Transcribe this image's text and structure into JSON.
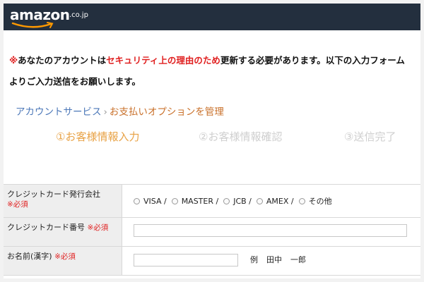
{
  "header": {
    "logo_text": "amazon",
    "logo_tld": ".co.jp"
  },
  "notice": {
    "mark": "※",
    "part1": "あなたのアカウントは",
    "highlight": "セキュリティ上の理由のため",
    "part2": "更新する必要があります。以下の入力フォームよりご入力送信をお願いします。"
  },
  "breadcrumb": {
    "item1": "アカウントサービス",
    "separator": "›",
    "item2": "お支払いオプションを管理"
  },
  "steps": [
    {
      "label": "①お客様情報入力",
      "active": true
    },
    {
      "label": "②お客様情報確認",
      "active": false
    },
    {
      "label": "③送信完了",
      "active": false
    }
  ],
  "form": {
    "card_company": {
      "label": "クレジットカード発行会社",
      "required": "※必須",
      "options": [
        "VISA /",
        "MASTER /",
        "JCB /",
        "AMEX /",
        "その他"
      ]
    },
    "card_number": {
      "label": "クレジットカード番号",
      "required": "※必須",
      "value": ""
    },
    "name_kanji": {
      "label": "お名前(漢字)",
      "required": "※必須",
      "value": "",
      "example_label": "例",
      "example_last": "田中",
      "example_first": "一郎"
    }
  },
  "colors": {
    "header_bg": "#232f3e",
    "logo_smile": "#ff9900",
    "required_red": "#e02020",
    "link_blue": "#4b77b8",
    "active_step": "#e8a245"
  }
}
